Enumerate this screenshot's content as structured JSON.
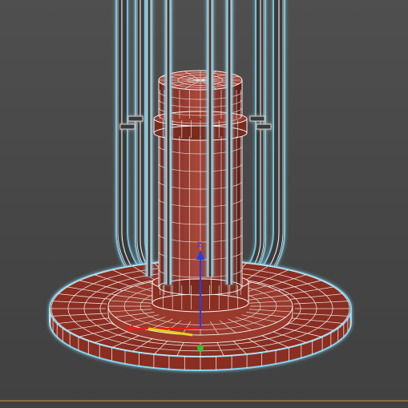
{
  "viewport": {
    "background": "#474747",
    "grid_line": "#b8874a"
  },
  "model": {
    "mesh_fill": "#8a2f22",
    "mesh_fill_light": "#a8473a",
    "wire_color": "#f2f2f2",
    "selection_glow": "#7fd6f0"
  },
  "gizmo": {
    "x_color": "#e02020",
    "y_color": "#e8d21a",
    "z_color": "#2040e8",
    "pivot_color": "#30c030",
    "z_label": "Z"
  }
}
